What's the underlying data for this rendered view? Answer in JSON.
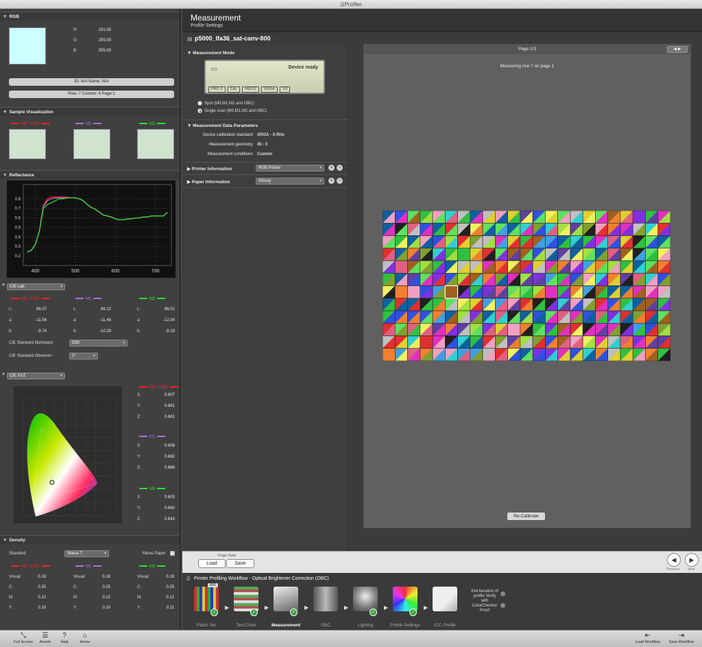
{
  "window": {
    "title": "i1Profiler"
  },
  "header": {
    "title": "Measurement",
    "subtitle": "Profile Settings"
  },
  "left": {
    "rgb": {
      "section": "RGB",
      "r_label": "R:",
      "r": "191.00",
      "g_label": "G:",
      "g": "255.00",
      "b_label": "B:",
      "b": "255.00",
      "swatch_color": "#ccffff",
      "id_bar": "ID: N/A    Name: N/A",
      "pos_bar": "Row: 7    Column: 6    Page:1"
    },
    "sample": {
      "section": "Sample Visualization",
      "m0": "M0 - OBC",
      "m1": "M1",
      "m2": "M2"
    },
    "reflectance": {
      "section": "Reflectance"
    },
    "lab": {
      "section_dropdown": "CIE Lab",
      "m0": "M0 - OBC",
      "m1": "M1",
      "m2": "M2",
      "L_label": "L:",
      "a_label": "a:",
      "b_label": "b:",
      "m0_L": "86.07",
      "m0_a": "-11.54",
      "m0_b": "-9.74",
      "m1_L": "86.12",
      "m1_a": "-11.46",
      "m1_b": "-10.29",
      "m2_L": "86.01",
      "m2_a": "-12.04",
      "m2_b": "-8.19",
      "illuminant_label": "CIE Standard Illuminant:",
      "illuminant": "D50",
      "observer_label": "CIE Standard Observer :",
      "observer": "2°"
    },
    "xyz": {
      "section_dropdown": "CIE XYZ",
      "m0": "M0 - OBC",
      "m1": "M1",
      "m2": "M2",
      "X_label": "X:",
      "Y_label": "Y:",
      "Z_label": "Z:",
      "m0_X": "0.607",
      "m0_Y": "0.681",
      "m0_Z": "0.661",
      "m1_X": "0.608",
      "m1_Y": "0.682",
      "m1_Z": "0.668",
      "m2_X": "0.603",
      "m2_Y": "0.680",
      "m2_Z": "0.643"
    },
    "density": {
      "section": "Density",
      "standard_label": "Standard:",
      "standard": "Status T",
      "minus_paper": "Minus Paper",
      "m0": "M0 - OBC",
      "m1": "M1",
      "m2": "M2",
      "visual_label": "Visual:",
      "c_label": "C:",
      "m_label": "M:",
      "y_label": "Y:",
      "m0_visual": "0.18",
      "m0_c": "0.25",
      "m0_m": "0.12",
      "m0_y": "0.10",
      "m1_visual": "0.18",
      "m1_c": "0.25",
      "m1_m": "0.12",
      "m1_y": "0.10",
      "m2_visual": "0.18",
      "m2_c": "0.25",
      "m2_m": "0.12",
      "m2_y": "0.11"
    }
  },
  "settings": {
    "file_name": "p5000_lfa36_sat-canv-800",
    "mode_section": "Measurement Mode",
    "device_status": "Device ready",
    "device_labels": [
      "PRO 3",
      "CAL",
      "M0/1/2",
      "XRGA",
      "1/3"
    ],
    "spot_label": "Spot (M0,M1,M2 and OBC)",
    "scan_label": "Single scan (M0,M1,M2 and OBC)",
    "params_section": "Measurement Data Parameters",
    "calib_label": "Device calibration standard:",
    "calib": "XRGA - X-Rite",
    "geometry_label": "Measurement geometry:",
    "geometry": "45 : 0",
    "conditions_label": "Measurement conditions:",
    "conditions": "Custom",
    "printer_label": "Printer Information",
    "printer": "RGB Printer",
    "paper_label": "Paper Information",
    "paper": "Glossy"
  },
  "page": {
    "label": "Page 1/3",
    "status": "Measuring row 7 on page 1",
    "recalibrate": "Re-Calibrate"
  },
  "footer": {
    "page_data": "Page Data",
    "load": "Load",
    "save": "Save",
    "previous": "Previous",
    "next": "Next"
  },
  "workflow": {
    "title": "Printer Profiling Workflow - Optical Brightener Correction (OBC)",
    "steps": [
      "Patch Set",
      "Test Chart",
      "Measurement",
      "OBC",
      "Lighting",
      "Profile Settings",
      "ICC Profile"
    ],
    "patch_badge": "800",
    "note": "2nd iteration of profile Verify with ColorChecker Proof"
  },
  "toolbar": {
    "full_screen": "Full Screen",
    "assets": "Assets",
    "help": "Help",
    "home": "Home",
    "load_workflow": "Load Workflow",
    "save_workflow": "Save Workflow"
  },
  "chart_data": {
    "type": "line",
    "title": "",
    "xlabel": "",
    "ylabel": "",
    "x": [
      380,
      390,
      400,
      410,
      420,
      430,
      440,
      450,
      460,
      470,
      480,
      490,
      500,
      510,
      520,
      530,
      540,
      550,
      560,
      570,
      580,
      590,
      600,
      610,
      620,
      630,
      640,
      650,
      660,
      670,
      680,
      690,
      700,
      710,
      720,
      730
    ],
    "series": [
      {
        "name": "M2",
        "values": [
          0.24,
          0.26,
          0.32,
          0.46,
          0.7,
          0.74,
          0.76,
          0.78,
          0.8,
          0.8,
          0.81,
          0.81,
          0.81,
          0.8,
          0.78,
          0.74,
          0.71,
          0.69,
          0.66,
          0.63,
          0.62,
          0.61,
          0.59,
          0.58,
          0.58,
          0.59,
          0.59,
          0.6,
          0.6,
          0.61,
          0.61,
          0.62,
          0.62,
          0.62,
          0.62,
          0.66
        ]
      },
      {
        "name": "M1",
        "values": [
          0.24,
          0.26,
          0.32,
          0.46,
          0.72,
          0.78,
          0.8,
          0.81,
          0.81,
          0.81,
          0.81,
          0.81,
          0.81,
          0.8,
          0.78,
          0.74,
          0.71,
          0.69,
          0.66,
          0.63,
          0.62,
          0.61,
          0.59,
          0.58,
          0.58,
          0.59,
          0.59,
          0.6,
          0.6,
          0.61,
          0.61,
          0.62,
          0.62,
          0.62,
          0.62,
          0.66
        ]
      },
      {
        "name": "M0 - OBC",
        "values": [
          0.24,
          0.26,
          0.32,
          0.46,
          0.73,
          0.8,
          0.82,
          0.82,
          0.82,
          0.82,
          0.82,
          0.81,
          0.81,
          0.8,
          0.78,
          0.74,
          0.71,
          0.69,
          0.66,
          0.63,
          0.62,
          0.61,
          0.59,
          0.58,
          0.58,
          0.59,
          0.59,
          0.6,
          0.6,
          0.61,
          0.61,
          0.62,
          0.62,
          0.62,
          0.62,
          0.66
        ]
      }
    ],
    "xlim": [
      370,
      740
    ],
    "ylim": [
      0.1,
      0.95
    ],
    "xticks": [
      400,
      500,
      600,
      700
    ],
    "yticks": [
      0.2,
      0.3,
      0.4,
      0.5,
      0.6,
      0.7,
      0.8
    ],
    "grid": true
  },
  "colors": {
    "m0": "#ff2020",
    "m1": "#b070e0",
    "m2": "#30e030",
    "accent": "#3aa040"
  }
}
